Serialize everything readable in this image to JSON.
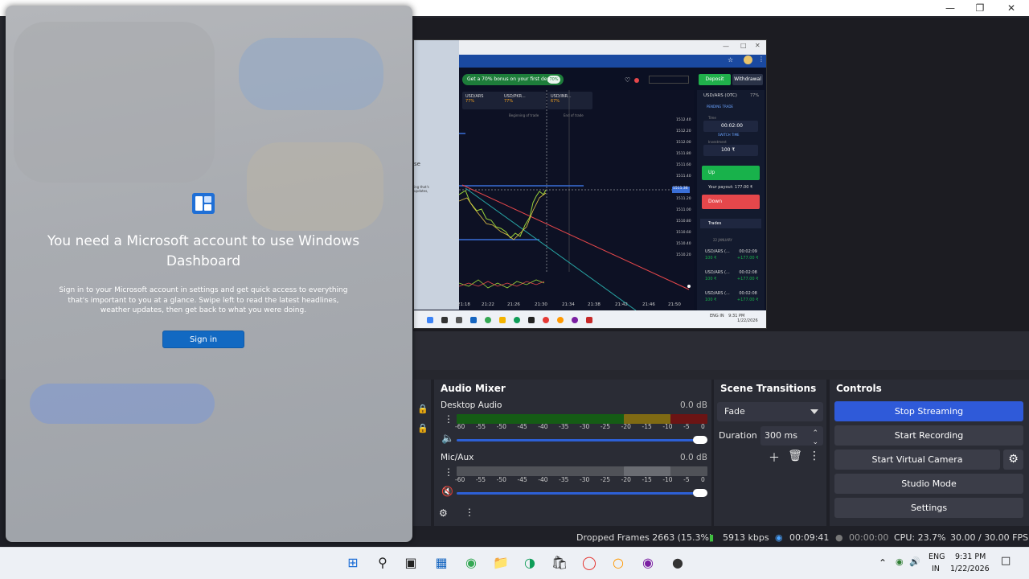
{
  "window": {
    "minimize_icon": "minimize-icon",
    "maximize_icon": "restore-icon",
    "close_icon": "close-icon"
  },
  "dashboard_overlay": {
    "title": "You need a Microsoft account to use Windows Dashboard",
    "body": "Sign in to your Microsoft account in settings and get quick access to everything that's important to you at a glance. Swipe left to read the latest headlines, weather updates, then get back to what you were doing.",
    "sign_in_label": "Sign in",
    "icon": "widgets-icon"
  },
  "captured_browser": {
    "bonus_text": "Get a 70% bonus on your first deposit",
    "bonus_pct": "70%",
    "deposit_label": "Deposit",
    "withdrawal_label": "Withdrawal",
    "asset_tabs": [
      {
        "name": "USD/ARS",
        "pct": "77%"
      },
      {
        "name": "USD/PKR...",
        "pct": "77%"
      },
      {
        "name": "USD/INR...",
        "pct": "67%"
      }
    ],
    "asset_title": "USD/ARS (OTC)",
    "asset_pct": "77%",
    "pending_trade": "PENDING TRADE",
    "time_label": "Time",
    "time_value": "00:02:00",
    "switch_time": "SWITCH TIME",
    "amount_label": "Investment",
    "amount_value": "100 ₹",
    "up_label": "Up",
    "down_label": "Down",
    "payout": "Your payout: 177.00 ₹",
    "trades_label": "Trades",
    "trades_date": "22 JANUARY",
    "trades": [
      {
        "asset": "USD/ARS (...",
        "time": "00:02:09",
        "amount": "100 ₹",
        "result": "+177.00 ₹"
      },
      {
        "asset": "USD/ARS (...",
        "time": "00:02:08",
        "amount": "100 ₹",
        "result": "+177.00 ₹"
      },
      {
        "asset": "USD/ARS (...",
        "time": "00:02:08",
        "amount": "100 ₹",
        "result": "+177.00 ₹"
      }
    ],
    "begin_trade": "Beginning of trade",
    "end_trade": "End of trade",
    "current_price": "1511.36",
    "time_ticks": [
      "21:18",
      "21:22",
      "21:26",
      "21:30",
      "21:34",
      "21:38",
      "21:42",
      "21:46",
      "21:50"
    ],
    "price_ticks": [
      "1512.40",
      "1512.20",
      "1512.00",
      "1511.80",
      "1511.60",
      "1511.40",
      "1511.20",
      "1511.00",
      "1510.80",
      "1510.60",
      "1510.40",
      "1510.20"
    ],
    "tray_lang": "ENG IN",
    "tray_time": "9:31 PM",
    "tray_date": "1/22/2026",
    "side_text": "se",
    "side_small": "ing that's updates,"
  },
  "audio_mixer": {
    "title": "Audio Mixer",
    "tracks": [
      {
        "name": "Desktop Audio",
        "db": "0.0 dB",
        "muted": false,
        "level": 0.87
      },
      {
        "name": "Mic/Aux",
        "db": "0.0 dB",
        "muted": true,
        "level": 0.85
      }
    ],
    "scale": [
      "-60",
      "-55",
      "-50",
      "-45",
      "-40",
      "-35",
      "-30",
      "-25",
      "-20",
      "-15",
      "-10",
      "-5",
      "0"
    ]
  },
  "scene_transitions": {
    "title": "Scene Transitions",
    "transition": "Fade",
    "duration_label": "Duration",
    "duration_value": "300 ms"
  },
  "controls": {
    "title": "Controls",
    "stop_streaming": "Stop Streaming",
    "start_recording": "Start Recording",
    "start_virtual_camera": "Start Virtual Camera",
    "studio_mode": "Studio Mode",
    "settings": "Settings"
  },
  "status": {
    "dropped_frames": "Dropped Frames 2663 (15.3%)",
    "bitrate": "5913 kbps",
    "stream_time": "00:09:41",
    "record_time": "00:00:00",
    "cpu": "CPU: 23.7%",
    "fps": "30.00 / 30.00 FPS"
  },
  "taskbar": {
    "lang_line1": "ENG",
    "lang_line2": "IN",
    "time": "9:31 PM",
    "date": "1/22/2026"
  },
  "colors": {
    "accent_blue": "#2f5ad9",
    "obs_panel": "#2a2c35",
    "signin_blue": "#1269c2",
    "up_green": "#18b24b",
    "down_red": "#e5474b"
  }
}
